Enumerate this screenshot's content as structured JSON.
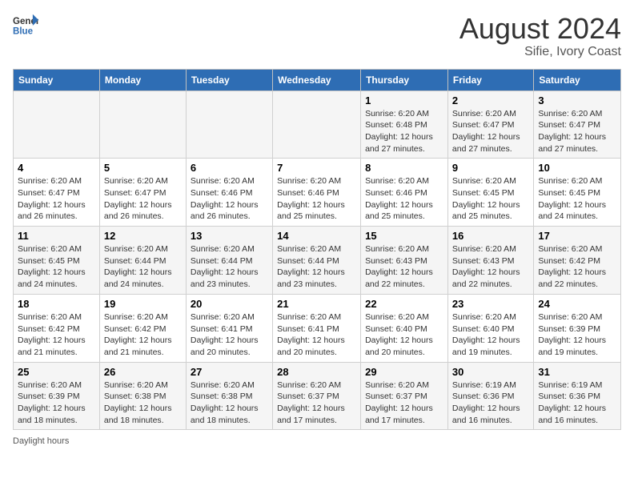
{
  "header": {
    "logo_general": "General",
    "logo_blue": "Blue",
    "main_title": "August 2024",
    "subtitle": "Sifie, Ivory Coast"
  },
  "days_of_week": [
    "Sunday",
    "Monday",
    "Tuesday",
    "Wednesday",
    "Thursday",
    "Friday",
    "Saturday"
  ],
  "weeks": [
    [
      {
        "day": "",
        "info": ""
      },
      {
        "day": "",
        "info": ""
      },
      {
        "day": "",
        "info": ""
      },
      {
        "day": "",
        "info": ""
      },
      {
        "day": "1",
        "info": "Sunrise: 6:20 AM\nSunset: 6:48 PM\nDaylight: 12 hours and 27 minutes."
      },
      {
        "day": "2",
        "info": "Sunrise: 6:20 AM\nSunset: 6:47 PM\nDaylight: 12 hours and 27 minutes."
      },
      {
        "day": "3",
        "info": "Sunrise: 6:20 AM\nSunset: 6:47 PM\nDaylight: 12 hours and 27 minutes."
      }
    ],
    [
      {
        "day": "4",
        "info": "Sunrise: 6:20 AM\nSunset: 6:47 PM\nDaylight: 12 hours and 26 minutes."
      },
      {
        "day": "5",
        "info": "Sunrise: 6:20 AM\nSunset: 6:47 PM\nDaylight: 12 hours and 26 minutes."
      },
      {
        "day": "6",
        "info": "Sunrise: 6:20 AM\nSunset: 6:46 PM\nDaylight: 12 hours and 26 minutes."
      },
      {
        "day": "7",
        "info": "Sunrise: 6:20 AM\nSunset: 6:46 PM\nDaylight: 12 hours and 25 minutes."
      },
      {
        "day": "8",
        "info": "Sunrise: 6:20 AM\nSunset: 6:46 PM\nDaylight: 12 hours and 25 minutes."
      },
      {
        "day": "9",
        "info": "Sunrise: 6:20 AM\nSunset: 6:45 PM\nDaylight: 12 hours and 25 minutes."
      },
      {
        "day": "10",
        "info": "Sunrise: 6:20 AM\nSunset: 6:45 PM\nDaylight: 12 hours and 24 minutes."
      }
    ],
    [
      {
        "day": "11",
        "info": "Sunrise: 6:20 AM\nSunset: 6:45 PM\nDaylight: 12 hours and 24 minutes."
      },
      {
        "day": "12",
        "info": "Sunrise: 6:20 AM\nSunset: 6:44 PM\nDaylight: 12 hours and 24 minutes."
      },
      {
        "day": "13",
        "info": "Sunrise: 6:20 AM\nSunset: 6:44 PM\nDaylight: 12 hours and 23 minutes."
      },
      {
        "day": "14",
        "info": "Sunrise: 6:20 AM\nSunset: 6:44 PM\nDaylight: 12 hours and 23 minutes."
      },
      {
        "day": "15",
        "info": "Sunrise: 6:20 AM\nSunset: 6:43 PM\nDaylight: 12 hours and 22 minutes."
      },
      {
        "day": "16",
        "info": "Sunrise: 6:20 AM\nSunset: 6:43 PM\nDaylight: 12 hours and 22 minutes."
      },
      {
        "day": "17",
        "info": "Sunrise: 6:20 AM\nSunset: 6:42 PM\nDaylight: 12 hours and 22 minutes."
      }
    ],
    [
      {
        "day": "18",
        "info": "Sunrise: 6:20 AM\nSunset: 6:42 PM\nDaylight: 12 hours and 21 minutes."
      },
      {
        "day": "19",
        "info": "Sunrise: 6:20 AM\nSunset: 6:42 PM\nDaylight: 12 hours and 21 minutes."
      },
      {
        "day": "20",
        "info": "Sunrise: 6:20 AM\nSunset: 6:41 PM\nDaylight: 12 hours and 20 minutes."
      },
      {
        "day": "21",
        "info": "Sunrise: 6:20 AM\nSunset: 6:41 PM\nDaylight: 12 hours and 20 minutes."
      },
      {
        "day": "22",
        "info": "Sunrise: 6:20 AM\nSunset: 6:40 PM\nDaylight: 12 hours and 20 minutes."
      },
      {
        "day": "23",
        "info": "Sunrise: 6:20 AM\nSunset: 6:40 PM\nDaylight: 12 hours and 19 minutes."
      },
      {
        "day": "24",
        "info": "Sunrise: 6:20 AM\nSunset: 6:39 PM\nDaylight: 12 hours and 19 minutes."
      }
    ],
    [
      {
        "day": "25",
        "info": "Sunrise: 6:20 AM\nSunset: 6:39 PM\nDaylight: 12 hours and 18 minutes."
      },
      {
        "day": "26",
        "info": "Sunrise: 6:20 AM\nSunset: 6:38 PM\nDaylight: 12 hours and 18 minutes."
      },
      {
        "day": "27",
        "info": "Sunrise: 6:20 AM\nSunset: 6:38 PM\nDaylight: 12 hours and 18 minutes."
      },
      {
        "day": "28",
        "info": "Sunrise: 6:20 AM\nSunset: 6:37 PM\nDaylight: 12 hours and 17 minutes."
      },
      {
        "day": "29",
        "info": "Sunrise: 6:20 AM\nSunset: 6:37 PM\nDaylight: 12 hours and 17 minutes."
      },
      {
        "day": "30",
        "info": "Sunrise: 6:19 AM\nSunset: 6:36 PM\nDaylight: 12 hours and 16 minutes."
      },
      {
        "day": "31",
        "info": "Sunrise: 6:19 AM\nSunset: 6:36 PM\nDaylight: 12 hours and 16 minutes."
      }
    ]
  ],
  "footer": {
    "daylight_label": "Daylight hours"
  }
}
